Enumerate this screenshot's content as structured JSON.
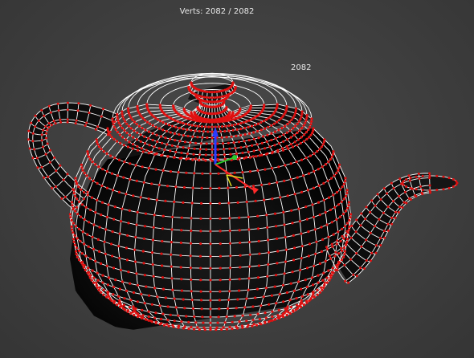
{
  "viewport": {
    "stats_text": "Verts: 2082 / 2082",
    "vertex_label": "2082",
    "background_color": "#414141",
    "mesh_color": "#ffffff",
    "vertex_color": "#e01010",
    "axis_colors": {
      "z": "#2a3cff",
      "x": "#ff2a2a",
      "y": "#2ad02a",
      "plane": "#e0e020"
    },
    "object": "teapot",
    "display_mode": "wireframe-with-vertices"
  }
}
